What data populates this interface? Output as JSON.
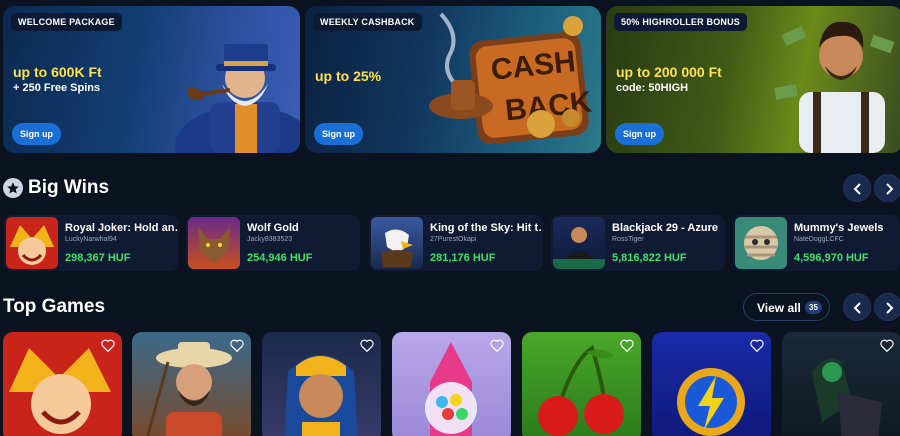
{
  "promos": [
    {
      "tag": "WELCOME PACKAGE",
      "headline": "up to 600K Ft",
      "subline": "+ 250 Free Spins",
      "button": "Sign up"
    },
    {
      "tag": "WEEKLY CASHBACK",
      "headline": "up to 25%",
      "subline": "",
      "button": "Sign up",
      "art_text_1": "CASH",
      "art_text_2": "BACK"
    },
    {
      "tag": "50% HIGHROLLER BONUS",
      "headline": "up to 200 000 Ft",
      "subline": "code: 50HIGH",
      "button": "Sign up"
    }
  ],
  "big_wins": {
    "title": "Big Wins",
    "items": [
      {
        "game": "Royal Joker: Hold an…",
        "player": "LuckyNarwhal94",
        "amount": "298,367 HUF"
      },
      {
        "game": "Wolf Gold",
        "player": "Jacky8383523",
        "amount": "254,946 HUF"
      },
      {
        "game": "King of the Sky: Hit t…",
        "player": "27PurestOkapi",
        "amount": "281,176 HUF"
      },
      {
        "game": "Blackjack 29 - Azure",
        "player": "RossTiger",
        "amount": "5,816,822 HUF"
      },
      {
        "game": "Mummy's Jewels",
        "player": "NateDoggLCFC",
        "amount": "4,596,970 HUF"
      }
    ]
  },
  "top_games": {
    "title": "Top Games",
    "view_all": "View all",
    "count": "35"
  },
  "colors": {
    "accent": "#1a6fd6",
    "win_amount": "#3ee06a",
    "highlight": "#ffe14d",
    "background": "#0b1220"
  }
}
